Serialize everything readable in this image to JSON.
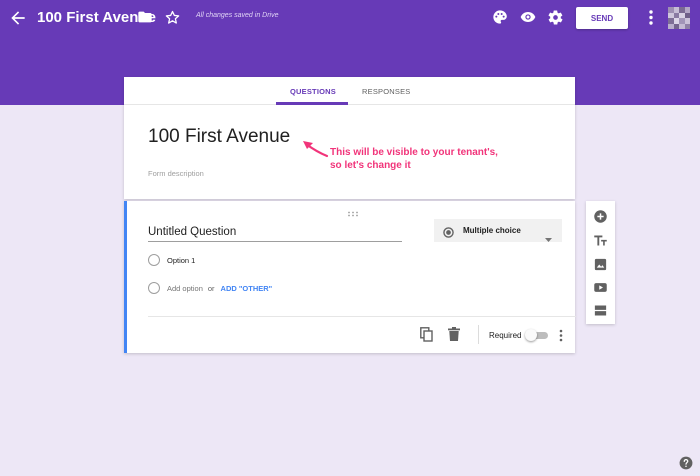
{
  "header": {
    "title": "100 First Avenue",
    "save_status": "All changes saved in Drive",
    "send_label": "SEND",
    "icons": [
      "back-arrow-icon",
      "folder-icon",
      "star-icon",
      "palette-icon",
      "eye-icon",
      "gear-icon",
      "more-vert-icon"
    ]
  },
  "tabs": [
    {
      "label": "QUESTIONS",
      "active": true
    },
    {
      "label": "RESPONSES",
      "active": false
    }
  ],
  "form": {
    "title": "100 First Avenue",
    "description_placeholder": "Form description"
  },
  "annotation": {
    "line1": "This will be visible to your tenant's,",
    "line2": "so let's change it"
  },
  "question": {
    "title": "Untitled Question",
    "type": "Multiple choice",
    "options": [
      "Option 1"
    ],
    "add_option": "Add option",
    "or": "or",
    "add_other": "ADD \"OTHER\"",
    "required_label": "Required",
    "required": false
  },
  "sidebar": [
    "add-question-icon",
    "title-text-icon",
    "image-icon",
    "video-icon",
    "section-icon"
  ],
  "colors": {
    "brand": "#673ab7",
    "background": "#ede7f6",
    "accent_blue": "#4285f4",
    "annotation": "#f1347a"
  }
}
